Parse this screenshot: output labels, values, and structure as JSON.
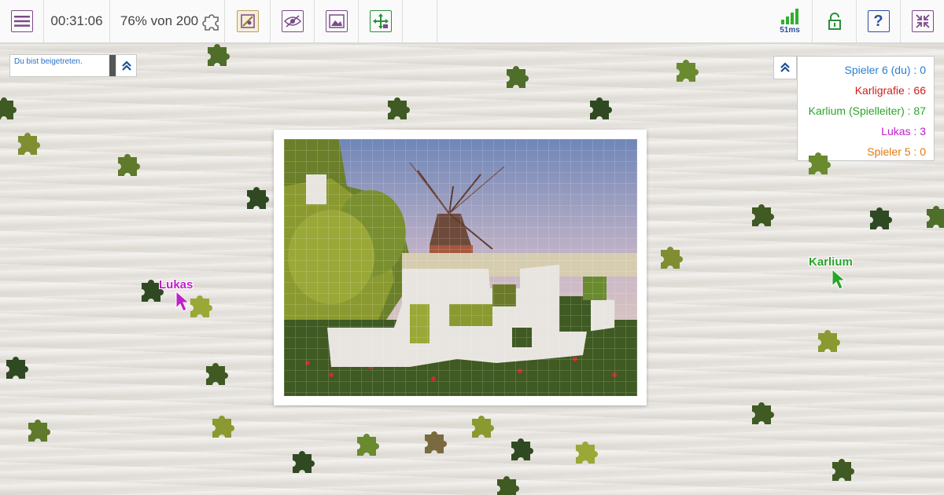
{
  "toolbar": {
    "menu_icon": "hamburger-menu-icon",
    "timer": "00:31:06",
    "progress_text": "76% von 200",
    "progress_fraction": 0.76,
    "ping": "51ms",
    "buttons": [
      "edge-pieces-icon",
      "hide-preview-icon",
      "image-preview-icon",
      "move-lock-icon",
      "signal-icon",
      "lock-icon",
      "help-icon",
      "fullscreen-exit-icon"
    ]
  },
  "chat": {
    "message": "Du bist beigetreten."
  },
  "scores": [
    {
      "text": "Spieler 6 (du) : 0",
      "color": "#2a7fd0"
    },
    {
      "text": "Karligrafie : 66",
      "color": "#d01c1c"
    },
    {
      "text": "Karlium (Spielleiter) : 87",
      "color": "#2aa32a"
    },
    {
      "text": "Lukas : 3",
      "color": "#c020c8"
    },
    {
      "text": "Spieler 5 : 0",
      "color": "#e07a10"
    }
  ],
  "cursors": [
    {
      "name": "Lukas",
      "color": "#c020c8"
    },
    {
      "name": "Karlium",
      "color": "#2aa32a"
    }
  ],
  "colors": {
    "accent": "#7c4a8a",
    "help_blue": "#2a4fa0",
    "signal_green": "#2db02d"
  }
}
